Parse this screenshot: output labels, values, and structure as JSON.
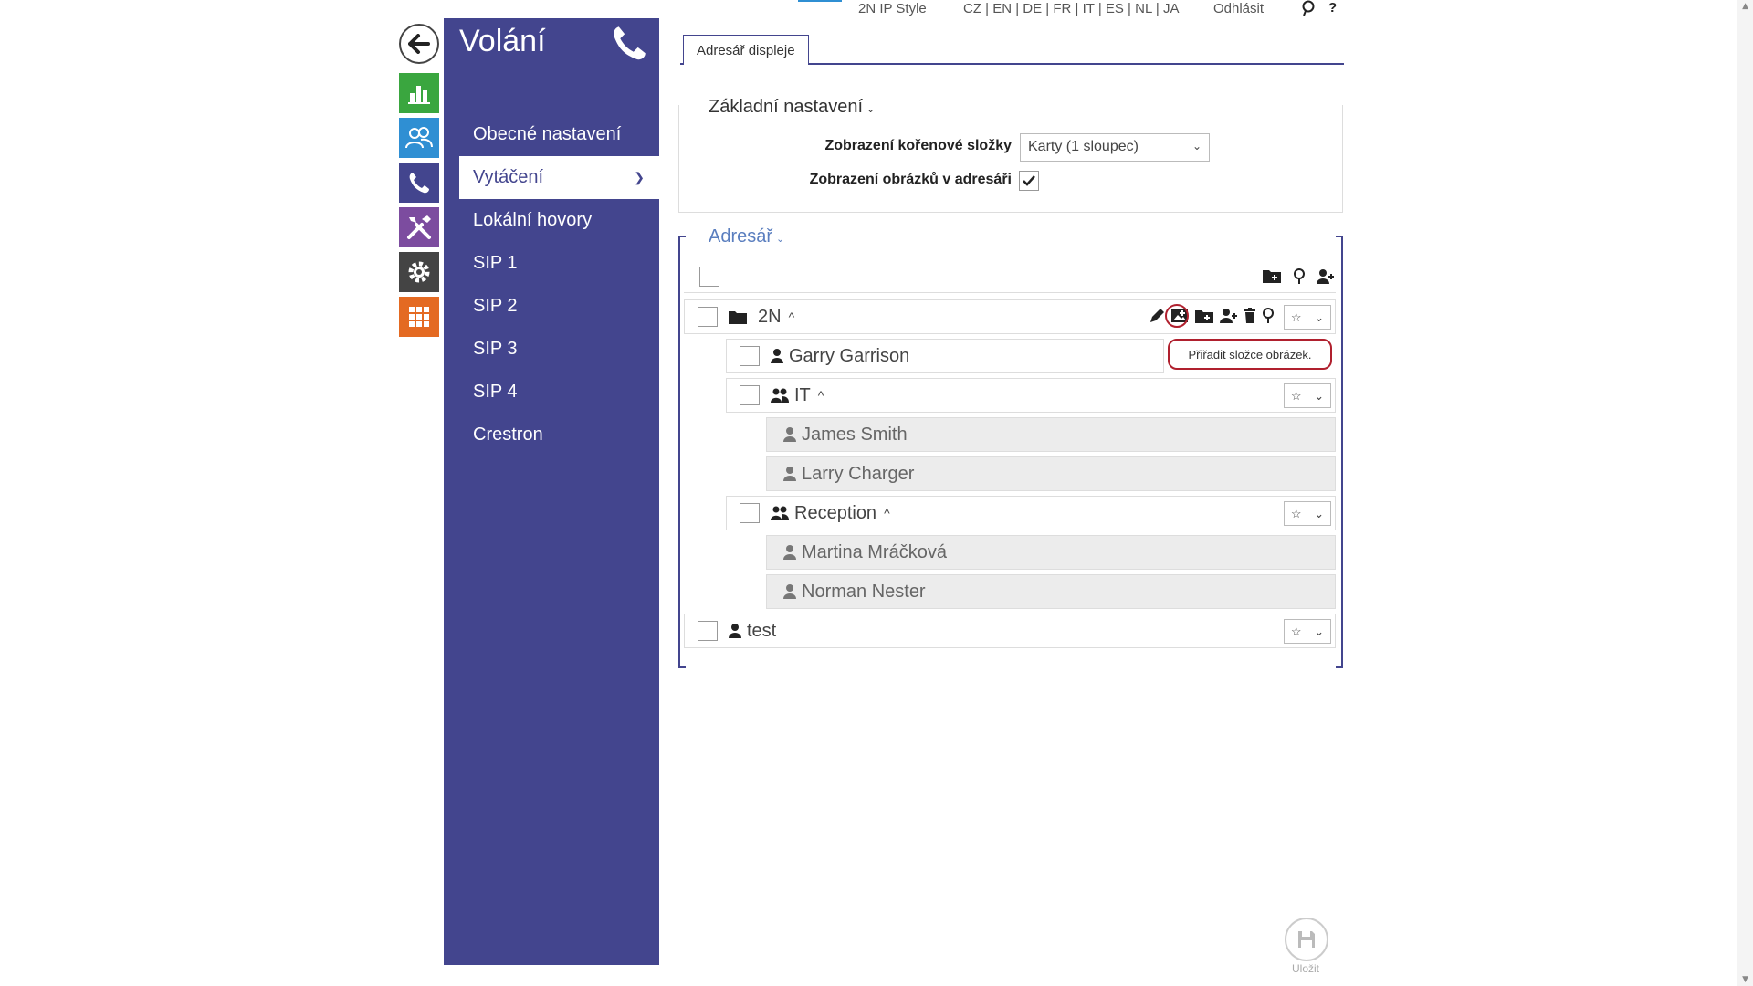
{
  "topbar": {
    "style_link": "2N IP Style",
    "languages": "CZ | EN | DE | FR | IT | ES | NL | JA",
    "logout": "Odhlásit",
    "help": "?"
  },
  "sidebar": {
    "title": "Volání",
    "items": [
      {
        "label": "Obecné nastavení"
      },
      {
        "label": "Vytáčení"
      },
      {
        "label": "Lokální hovory"
      },
      {
        "label": "SIP 1"
      },
      {
        "label": "SIP 2"
      },
      {
        "label": "SIP 3"
      },
      {
        "label": "SIP 4"
      },
      {
        "label": "Crestron"
      }
    ]
  },
  "tabs": [
    {
      "label": "Adresář displeje"
    }
  ],
  "basic": {
    "title": "Základní nastavení",
    "root_folder_label": "Zobrazení kořenové složky",
    "root_folder_value": "Karty (1 sloupec)",
    "images_label": "Zobrazení obrázků v adresáři"
  },
  "directory": {
    "title": "Adresář",
    "tree": [
      {
        "label": "2N"
      },
      {
        "label": "Garry Garrison"
      },
      {
        "label": "IT"
      },
      {
        "label": "James Smith"
      },
      {
        "label": "Larry Charger"
      },
      {
        "label": "Reception"
      },
      {
        "label": "Martina Mráčková"
      },
      {
        "label": "Norman Nester"
      },
      {
        "label": "test"
      }
    ]
  },
  "tooltip": "Přiřadit složce obrázek.",
  "save_label": "Uložit",
  "colors": {
    "accent": "#43458e",
    "highlight": "#b0202e"
  }
}
